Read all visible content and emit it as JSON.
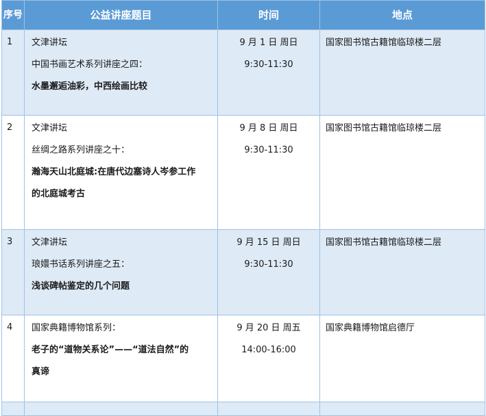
{
  "header": {
    "no": "序号",
    "title": "公益讲座题目",
    "time": "时间",
    "place": "地点"
  },
  "rows": [
    {
      "no": "1",
      "series": "文津讲坛",
      "subtitle": "中国书画艺术系列讲座之四：",
      "topic": "水墨邂逅油彩，中西绘画比较",
      "date": "9 月 1 日  周日",
      "hours": "9:30-11:30",
      "place": "国家图书馆古籍馆临琼楼二层"
    },
    {
      "no": "2",
      "series": "文津讲坛",
      "subtitle": "丝绸之路系列讲座之十：",
      "topic_line1": "瀚海天山北庭城:在唐代边塞诗人岑参工作",
      "topic_line2": "的北庭城考古",
      "date": "9 月 8 日  周日",
      "hours": "9:30-11:30",
      "place": "国家图书馆古籍馆临琼楼二层"
    },
    {
      "no": "3",
      "series": "文津讲坛",
      "subtitle": "琅嬛书话系列讲座之五：",
      "topic": "浅谈碑帖鉴定的几个问题",
      "date": "9 月 15 日  周日",
      "hours": "9:30-11:30",
      "place": "国家图书馆古籍馆临琼楼二层"
    },
    {
      "no": "4",
      "series": "国家典籍博物馆系列：",
      "topic_line1": "老子的“道物关系论”——“道法自然”的",
      "topic_line2": "真谛",
      "date": "9 月 20 日  周五",
      "hours": "14:00-16:00",
      "place": "国家典籍博物馆启德厅"
    }
  ]
}
